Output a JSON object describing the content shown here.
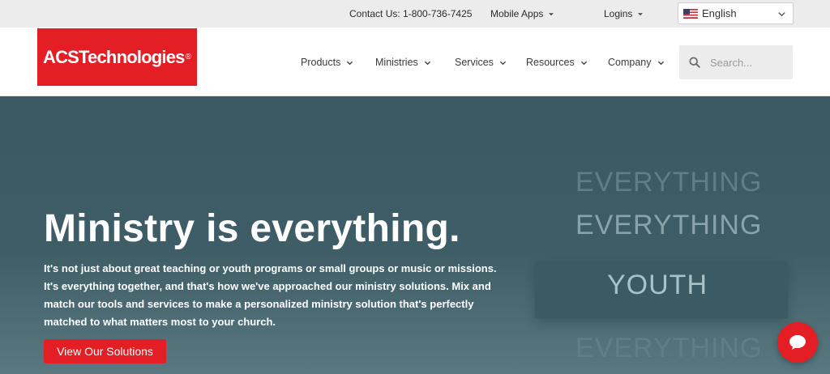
{
  "topbar": {
    "contact": "Contact Us: 1-800-736-7425",
    "mobile_apps": "Mobile Apps",
    "logins": "Logins",
    "language": "English"
  },
  "logo": {
    "text": "ACSTechnologies",
    "mark": "®"
  },
  "nav": {
    "items": [
      {
        "label": "Products"
      },
      {
        "label": "Ministries"
      },
      {
        "label": "Services"
      },
      {
        "label": "Resources"
      },
      {
        "label": "Company"
      }
    ],
    "search_placeholder": "Search..."
  },
  "hero": {
    "title": "Ministry is everything.",
    "body": "It's not just about great teaching or youth programs or small groups or music or missions. It's everything together, and that's how we've approached our ministry solutions. Mix and match our tools and services to make a personalized ministry solution that's perfectly matched to what matters most to your church.",
    "cta": "View Our Solutions",
    "words": [
      "EVERYTHING",
      "EVERYTHING",
      "YOUTH",
      "EVERYTHING"
    ]
  },
  "colors": {
    "brand_red": "#e31e24",
    "hero_bg": "#3d5c65"
  },
  "icons": {
    "chat": "chat-bubble-icon",
    "search": "search-icon",
    "flag": "us-flag-icon"
  }
}
